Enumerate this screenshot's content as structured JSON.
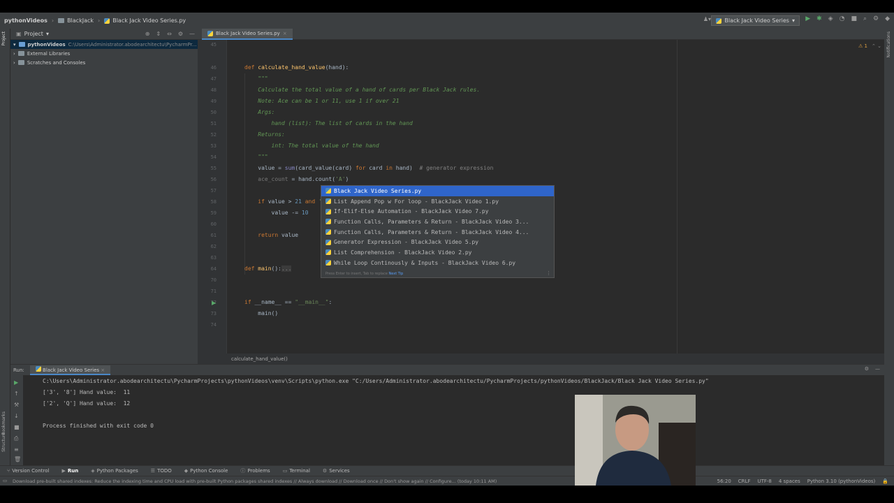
{
  "navbar": {
    "project": "pythonVideos",
    "folder": "BlackJack",
    "file": "Black Jack Video Series.py",
    "run_config": "Black Jack Video Series"
  },
  "project_panel": {
    "title": "Project",
    "items": [
      {
        "label": "pythonVideos",
        "path": "C:\\Users\\Administrator.abodearchitectu\\PycharmPr..."
      },
      {
        "label": "External Libraries"
      },
      {
        "label": "Scratches and Consoles"
      }
    ]
  },
  "left_stripe": {
    "project": "Project",
    "bookmarks": "Bookmarks",
    "structure": "Structure"
  },
  "right_stripe": {
    "notifications": "Notifications"
  },
  "editor": {
    "tab": "Black Jack Video Series.py",
    "warnings": "1",
    "line_numbers": [
      "45",
      "46",
      "47",
      "48",
      "49",
      "50",
      "51",
      "52",
      "53",
      "54",
      "55",
      "56",
      "57",
      "58",
      "59",
      "60",
      "61",
      "62",
      "63",
      "64",
      "70",
      "71",
      "72",
      "73",
      "74"
    ],
    "breadcrumb": "calculate_hand_value()"
  },
  "completion": {
    "items": [
      "Black Jack Video Series.py",
      "List Append Pop w For loop - BlackJack Video 1.py",
      "If-Elif-Else Automation - BlackJack Video 7.py",
      "Function Calls, Parameters & Return - BlackJack Video 3...",
      "Function Calls, Parameters & Return - BlackJack Video 4...",
      "Generator Expression - BlackJack Video 5.py",
      "List Comprehension - BlackJack Video 2.py",
      "While Loop Continously & Inputs - BlackJack Video 6.py"
    ],
    "hint": "Press Enter to insert, Tab to replace",
    "hint_link": "Next Tip"
  },
  "run": {
    "label": "Run:",
    "tab": "Black Jack Video Series",
    "lines": [
      "C:\\Users\\Administrator.abodearchitectu\\PycharmProjects\\pythonVideos\\venv\\Scripts\\python.exe \"C:/Users/Administrator.abodearchitectu/PycharmProjects/pythonVideos/BlackJack/Black Jack Video Series.py\"",
      "['3', '8'] Hand value:  11",
      "['2', 'Q'] Hand value:  12",
      "",
      "Process finished with exit code 0"
    ]
  },
  "bottom_tabs": [
    "Version Control",
    "Run",
    "Python Packages",
    "TODO",
    "Python Console",
    "Problems",
    "Terminal",
    "Services"
  ],
  "status": {
    "message": "Download pre-built shared indexes: Reduce the indexing time and CPU load with pre-built Python packages shared indexes // Always download // Download once // Don't show again // Configure... (today 10:11 AM)",
    "position": "56:20",
    "line_sep": "CRLF",
    "encoding": "UTF-8",
    "indent": "4 spaces",
    "interpreter": "Python 3.10 (pythonVideos)"
  }
}
